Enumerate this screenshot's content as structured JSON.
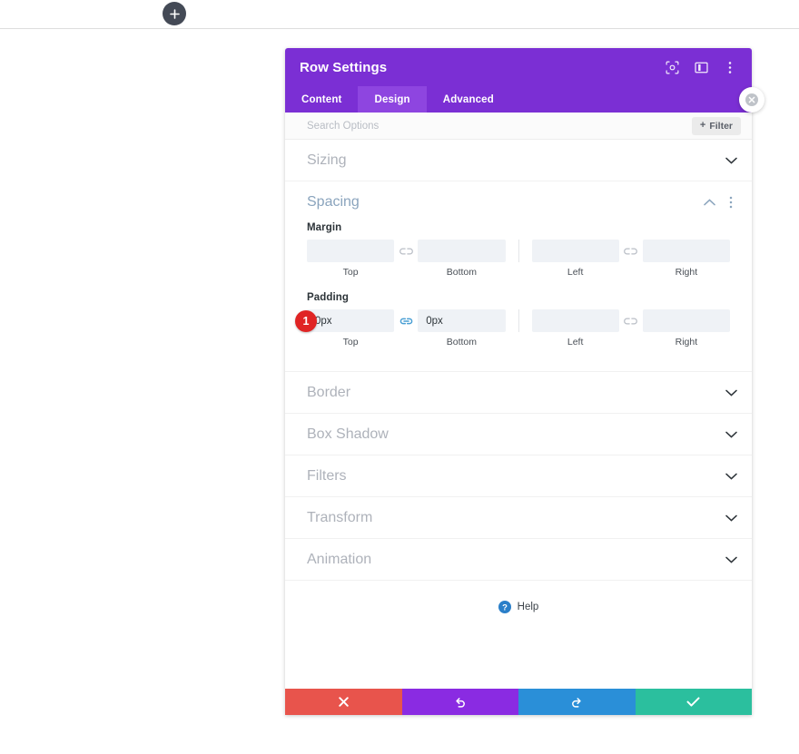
{
  "canvas": {
    "add_section_button": "+",
    "add_section_icon": "plus-icon"
  },
  "modal": {
    "title": "Row Settings",
    "header_icons": [
      {
        "name": "focus-target-icon"
      },
      {
        "name": "panel-layout-icon"
      },
      {
        "name": "more-options-icon"
      }
    ],
    "close_icon": "close-icon",
    "tabs": [
      {
        "label": "Content",
        "active": false
      },
      {
        "label": "Design",
        "active": true
      },
      {
        "label": "Advanced",
        "active": false
      }
    ],
    "search": {
      "placeholder": "Search Options",
      "value": "",
      "filter_label": "Filter",
      "filter_plus": "+"
    },
    "sections": [
      {
        "label": "Sizing",
        "open": false
      },
      {
        "label": "Spacing",
        "open": true
      },
      {
        "label": "Border",
        "open": false
      },
      {
        "label": "Box Shadow",
        "open": false
      },
      {
        "label": "Filters",
        "open": false
      },
      {
        "label": "Transform",
        "open": false
      },
      {
        "label": "Animation",
        "open": false
      }
    ],
    "spacing": {
      "badge": "1",
      "margin": {
        "label": "Margin",
        "fields": [
          {
            "caption": "Top",
            "value": "",
            "placeholder": ""
          },
          {
            "caption": "Bottom",
            "value": "",
            "placeholder": ""
          },
          {
            "caption": "Left",
            "value": "",
            "placeholder": ""
          },
          {
            "caption": "Right",
            "value": "",
            "placeholder": ""
          }
        ],
        "link_left_icon": "broken-link-icon",
        "link_right_icon": "broken-link-icon",
        "link_left_active": false,
        "link_right_active": false
      },
      "padding": {
        "label": "Padding",
        "fields": [
          {
            "caption": "Top",
            "value": "0px",
            "placeholder": ""
          },
          {
            "caption": "Bottom",
            "value": "0px",
            "placeholder": ""
          },
          {
            "caption": "Left",
            "value": "",
            "placeholder": ""
          },
          {
            "caption": "Right",
            "value": "",
            "placeholder": ""
          }
        ],
        "link_left_icon": "linked-chain-icon",
        "link_right_icon": "broken-link-icon",
        "link_left_active": true,
        "link_right_active": false
      }
    },
    "help": {
      "label": "Help",
      "icon": "question-circle-icon"
    },
    "footer_actions": [
      {
        "name": "discard-button",
        "icon": "close-icon",
        "color": "#e8544c"
      },
      {
        "name": "undo-button",
        "icon": "undo-icon",
        "color": "#8a2be2"
      },
      {
        "name": "redo-button",
        "icon": "redo-icon",
        "color": "#2a8fd8"
      },
      {
        "name": "save-button",
        "icon": "check-icon",
        "color": "#2bbf9e"
      }
    ]
  },
  "colors": {
    "header_purple": "#7B2FD4",
    "tab_active_purple": "#8E45E0",
    "badge_red": "#e02424",
    "link_active": "#4a9fd4",
    "section_open_blue": "#8aa4bd"
  }
}
